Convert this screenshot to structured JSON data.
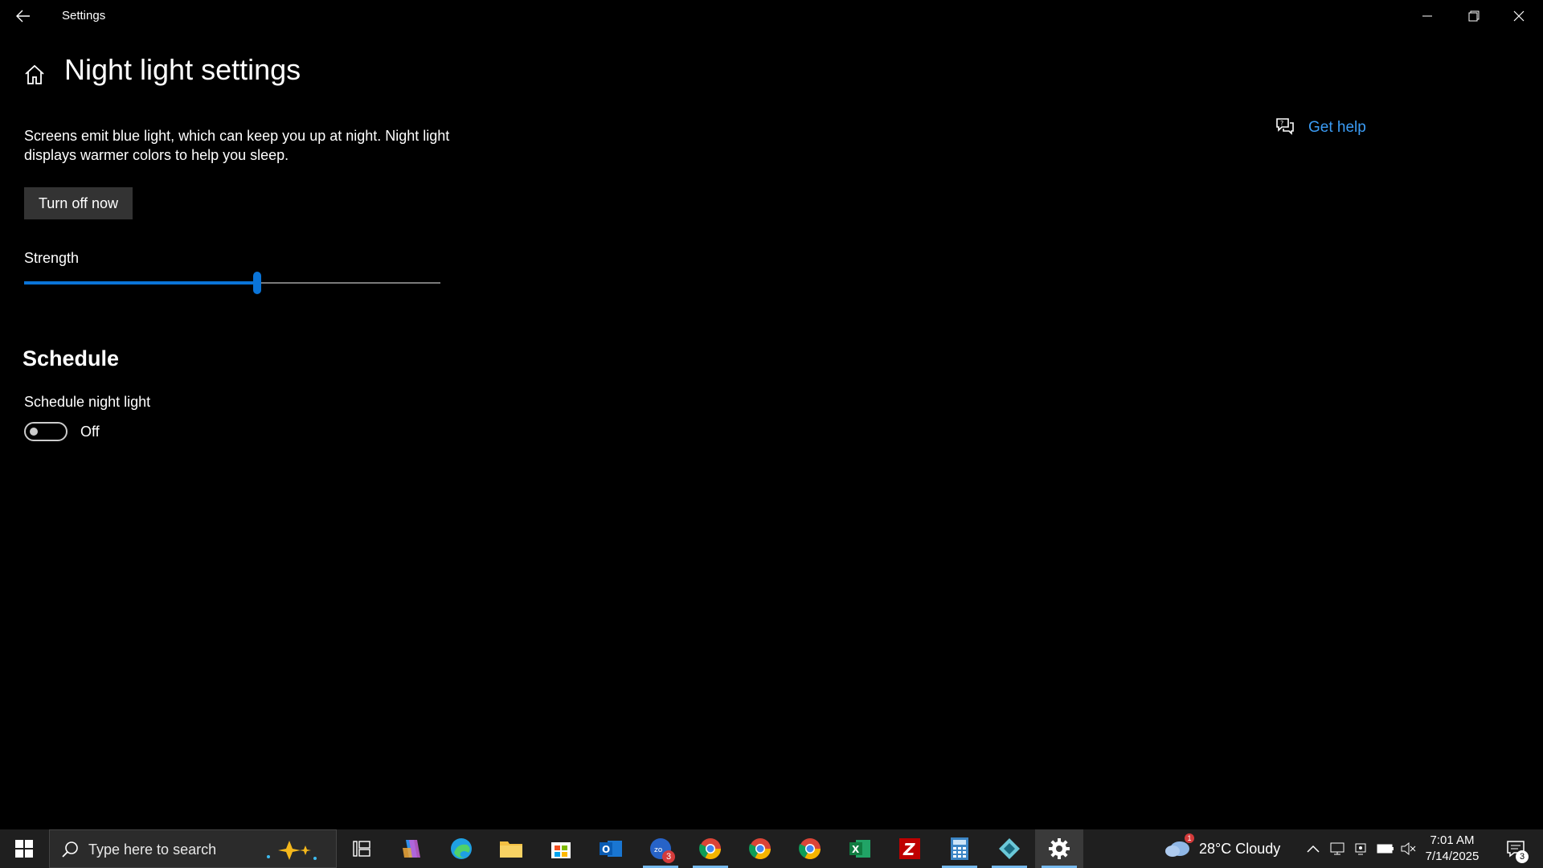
{
  "titlebar": {
    "title": "Settings",
    "back_icon": "back-arrow-icon",
    "minimize_icon": "minimize-icon",
    "restore_icon": "restore-icon",
    "close_icon": "close-icon"
  },
  "page": {
    "title": "Night light settings",
    "description": "Screens emit blue light, which can keep you up at night. Night light displays warmer colors to help you sleep.",
    "turn_off_button": "Turn off now",
    "strength": {
      "label": "Strength",
      "value_percent": 56
    },
    "schedule": {
      "section_title": "Schedule",
      "toggle_label": "Schedule night light",
      "toggle_state": "Off",
      "toggle_on": false
    },
    "help": {
      "label": "Get help",
      "icon": "help-chat-icon"
    },
    "accent_color": "#0a74d8",
    "link_color": "#3b9cf5"
  },
  "taskbar": {
    "search_placeholder": "Type here to search",
    "apps": [
      {
        "name": "task-view",
        "icon": "task-view-icon"
      },
      {
        "name": "copilot",
        "icon": "copilot-icon"
      },
      {
        "name": "edge",
        "icon": "edge-icon"
      },
      {
        "name": "file-explorer",
        "icon": "folder-icon"
      },
      {
        "name": "microsoft-store",
        "icon": "store-icon"
      },
      {
        "name": "outlook",
        "icon": "outlook-icon"
      },
      {
        "name": "zoho",
        "icon": "zoho-icon",
        "badge": "3"
      },
      {
        "name": "chrome-1",
        "icon": "chrome-icon"
      },
      {
        "name": "chrome-2",
        "icon": "chrome-icon"
      },
      {
        "name": "chrome-3",
        "icon": "chrome-icon"
      },
      {
        "name": "excel",
        "icon": "excel-icon"
      },
      {
        "name": "filezilla",
        "icon": "filezilla-icon"
      },
      {
        "name": "calculator",
        "icon": "calculator-icon"
      },
      {
        "name": "app-diamond",
        "icon": "diamond-app-icon"
      },
      {
        "name": "settings",
        "icon": "gear-icon"
      }
    ],
    "weather": {
      "text": "28°C  Cloudy",
      "alert": "1"
    },
    "clock": {
      "time": "7:01 AM",
      "date": "7/14/2025"
    },
    "notifications_count": "3"
  }
}
